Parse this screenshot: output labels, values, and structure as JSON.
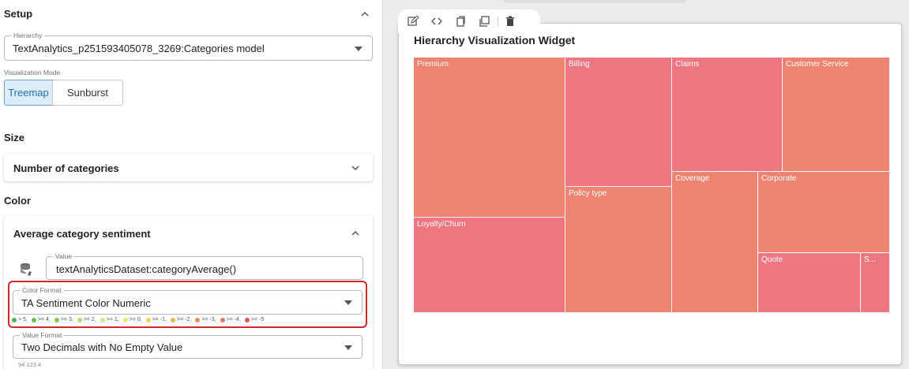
{
  "left": {
    "setup": {
      "title": "Setup"
    },
    "hierarchy": {
      "legend": "Hierarchy",
      "value": "TextAnalytics_p251593405078_3269:Categories model"
    },
    "visualization_mode": {
      "label": "Visualization Mode",
      "options": [
        "Treemap",
        "Sunburst"
      ],
      "selected": "Treemap"
    },
    "size": {
      "title": "Size",
      "card_title": "Number of categories"
    },
    "color": {
      "title": "Color",
      "card_title": "Average category sentiment",
      "value_field": {
        "legend": "Value",
        "value": "textAnalyticsDataset:categoryAverage()"
      },
      "color_format": {
        "legend": "Color Format",
        "value": "TA Sentiment Color Numeric"
      },
      "color_legend": [
        {
          "label": "> 5",
          "color": "#4caf50"
        },
        {
          "label": ">= 4",
          "color": "#6cc04a"
        },
        {
          "label": ">= 3",
          "color": "#8bc34a"
        },
        {
          "label": ">= 2",
          "color": "#b5d96a"
        },
        {
          "label": ">= 1",
          "color": "#d6e88a"
        },
        {
          "label": ">= 0",
          "color": "#f2e96a"
        },
        {
          "label": ">= -1",
          "color": "#f5d44f"
        },
        {
          "label": ">= -2",
          "color": "#f0b04a"
        },
        {
          "label": ">= -3",
          "color": "#ee8a5a"
        },
        {
          "label": ">= -4",
          "color": "#ee7060"
        },
        {
          "label": ">= -5",
          "color": "#e85050"
        }
      ],
      "value_format": {
        "legend": "Value Format",
        "value": "Two Decimals with No Empty Value",
        "sample": "94 123.4"
      }
    }
  },
  "widget": {
    "title": "Hierarchy Visualization Widget",
    "toolbar": [
      "edit-icon",
      "code-icon",
      "copy-icon",
      "duplicate-icon",
      "delete-icon"
    ],
    "treemap": {
      "cells": [
        {
          "label": "Premium",
          "color": "#ee8470"
        },
        {
          "label": "Loyalty/Churn",
          "color": "#ee7680"
        },
        {
          "label": "Billing",
          "color": "#ee7680"
        },
        {
          "label": "Policy type",
          "color": "#ee8470"
        },
        {
          "label": "Claims",
          "color": "#ee7680"
        },
        {
          "label": "Customer Service",
          "color": "#ee8470"
        },
        {
          "label": "Coverage",
          "color": "#ee8470"
        },
        {
          "label": "Corporate",
          "color": "#ee8470"
        },
        {
          "label": "Quote",
          "color": "#ee7680"
        },
        {
          "label": "S...",
          "color": "#ee7680"
        }
      ]
    }
  }
}
